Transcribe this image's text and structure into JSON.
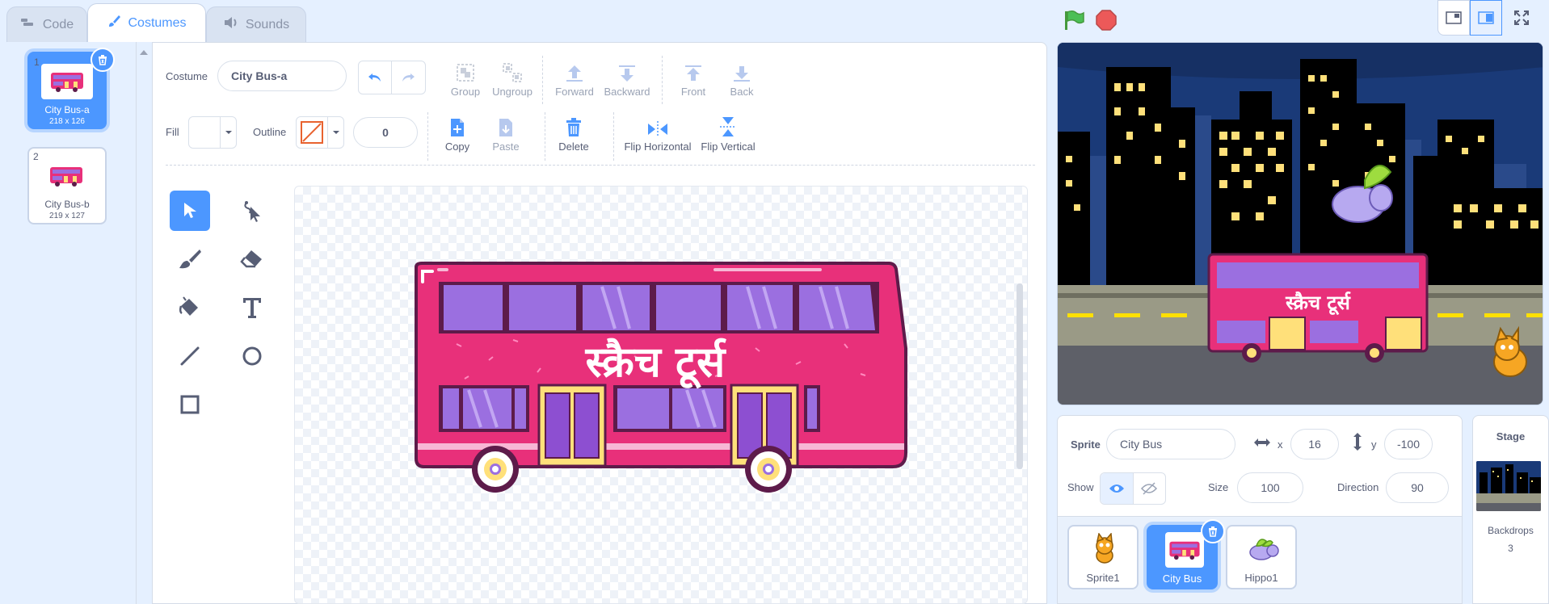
{
  "tabs": [
    {
      "label": "Code",
      "icon": "code-icon"
    },
    {
      "label": "Costumes",
      "icon": "brush-icon"
    },
    {
      "label": "Sounds",
      "icon": "speaker-icon"
    }
  ],
  "controls": {
    "green_flag": "green-flag-icon",
    "stop": "stop-icon"
  },
  "costumes": [
    {
      "number": "1",
      "name": "City Bus-a",
      "size": "218 x 126",
      "selected": true
    },
    {
      "number": "2",
      "name": "City Bus-b",
      "size": "219 x 127",
      "selected": false
    }
  ],
  "toolbar": {
    "costume_label": "Costume",
    "costume_name": "City Bus-a",
    "group": "Group",
    "ungroup": "Ungroup",
    "forward": "Forward",
    "backward": "Backward",
    "front": "Front",
    "back": "Back",
    "fill_label": "Fill",
    "outline_label": "Outline",
    "outline_width": "0",
    "copy": "Copy",
    "paste": "Paste",
    "delete": "Delete",
    "flip_horizontal": "Flip Horizontal",
    "flip_vertical": "Flip Vertical"
  },
  "bus_text": "स्क्रैच टूर्स",
  "sprite_info": {
    "sprite_label": "Sprite",
    "sprite_name": "City Bus",
    "x_label": "x",
    "x_value": "16",
    "y_label": "y",
    "y_value": "-100",
    "show_label": "Show",
    "size_label": "Size",
    "size_value": "100",
    "direction_label": "Direction",
    "direction_value": "90"
  },
  "sprites": [
    {
      "name": "Sprite1",
      "selected": false
    },
    {
      "name": "City Bus",
      "selected": true
    },
    {
      "name": "Hippo1",
      "selected": false
    }
  ],
  "stage_panel": {
    "title": "Stage",
    "backdrops_label": "Backdrops",
    "backdrops_count": "3"
  },
  "colors": {
    "accent": "#4c97ff",
    "bus_pink": "#e8307a",
    "window_purple": "#9b6fe0"
  }
}
